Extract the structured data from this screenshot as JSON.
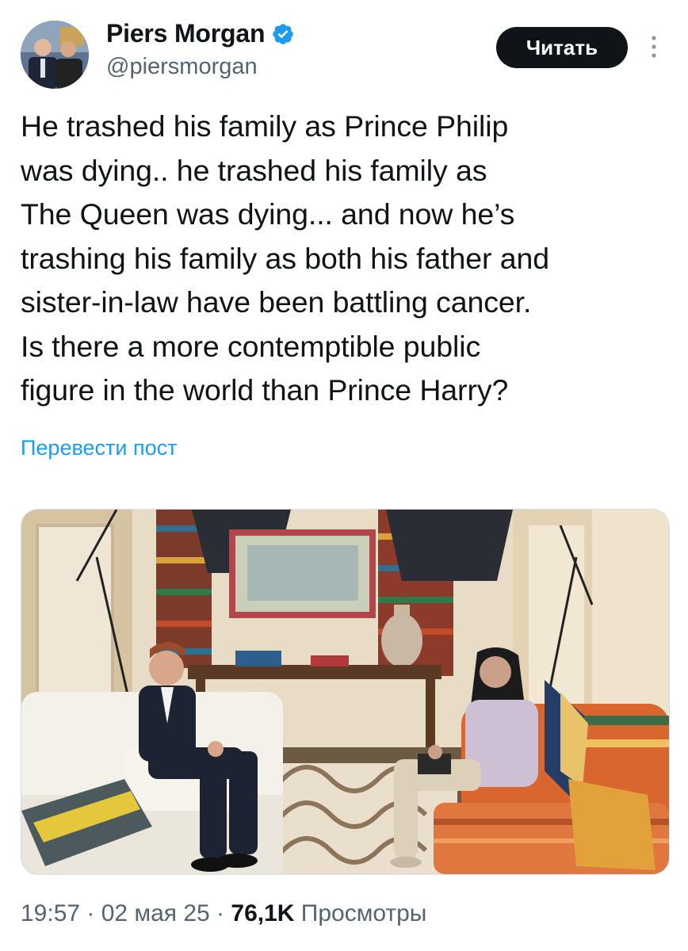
{
  "author": {
    "name": "Piers Morgan",
    "handle": "@piersmorgan",
    "verified_icon": "verified-badge-icon",
    "badge_color": "#1d9bf0"
  },
  "header": {
    "follow_label": "Читать",
    "more_icon": "more-vertical-icon"
  },
  "tweet": {
    "lines": [
      "He trashed his family as Prince Philip",
      "was dying.. he trashed his family as",
      "The Queen was dying... and now he’s",
      "trashing his family as both his father and",
      "sister-in-law have been battling cancer.",
      "Is there a more contemptible public",
      "figure in the world than Prince Harry?"
    ],
    "translate_label": "Перевести пост"
  },
  "meta": {
    "time": "19:57",
    "sep1": " · ",
    "date": "02 мая 25",
    "sep2": " · ",
    "views_count": "76,1K",
    "views_label": " Просмотры"
  },
  "colors": {
    "text": "#0f1419",
    "secondary": "#536471",
    "link": "#1d9bf0",
    "button_bg": "#0f1419"
  }
}
